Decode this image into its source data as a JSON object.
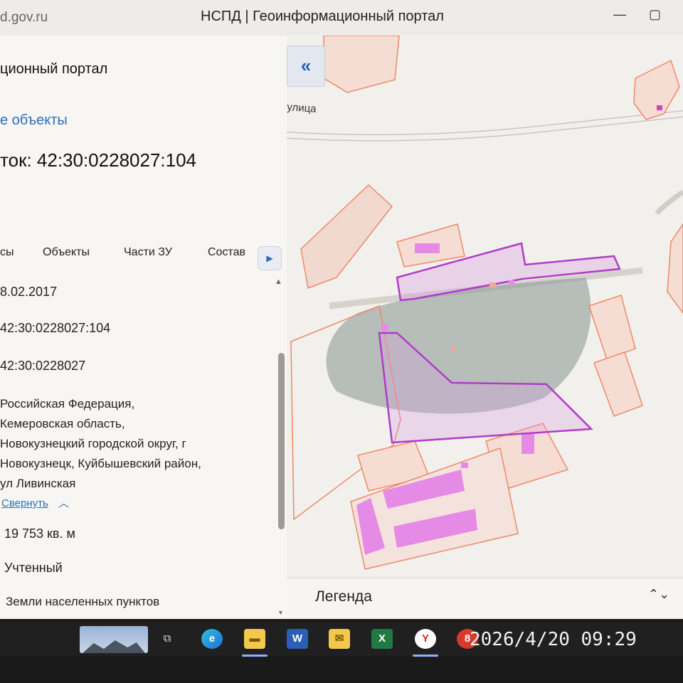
{
  "browser": {
    "url": "d.gov.ru",
    "tab_title": "НСПД | Геоинформационный портал",
    "controls": {
      "minimize": "—",
      "maximize": "▢"
    }
  },
  "panel": {
    "portal_title": "ционный портал",
    "objects_link": "е объекты",
    "parcel_title": "ток: 42:30:0228027:104",
    "tabs": [
      "сы",
      "Объекты",
      "Части ЗУ",
      "Состав"
    ],
    "fields": {
      "date": "8.02.2017",
      "cadastral_number": "42:30:0228027:104",
      "quarter": "42:30:0228027",
      "address_lines": [
        "Российская Федерация,",
        "Кемеровская область,",
        "Новокузнецкий городской округ, г",
        "Новокузнецк, Куйбышевский район,",
        "ул Ливинская"
      ],
      "collapse_label": "Свернуть",
      "area": "19 753 кв. м",
      "status": "Учтенный",
      "category": "Земли населенных пунктов"
    }
  },
  "map": {
    "collapse_glyph": "«",
    "street_label": "улица",
    "legend_label": "Легенда",
    "legend_toggle": "⌃⌄",
    "colors": {
      "parcel_line": "#ee8866",
      "selected": "#b03cc8",
      "building_fill": "#e58be6",
      "relief": "#8f9b97"
    }
  },
  "taskbar": {
    "icons": [
      "task-view-icon",
      "edge-icon",
      "file-explorer-icon",
      "word-icon",
      "mail-icon",
      "excel-icon",
      "yandex-browser-icon",
      "notification-icon"
    ],
    "clock": "2026/4/20 09:29"
  }
}
